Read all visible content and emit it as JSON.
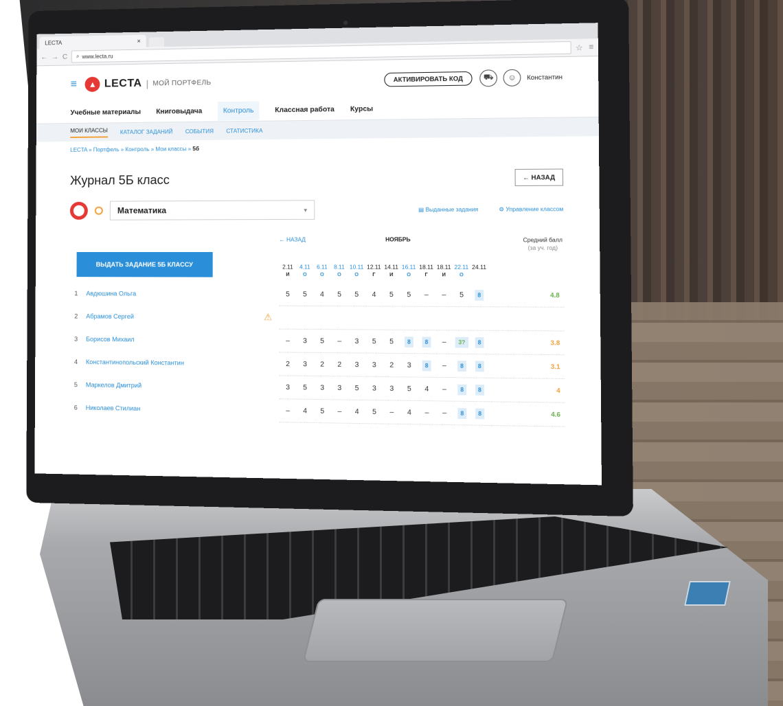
{
  "browser": {
    "tab_title": "LECTA",
    "tab_close": "×",
    "url": "www.lecta.ru"
  },
  "header": {
    "brand": "LECTA",
    "separator": "|",
    "subtitle": "МОЙ ПОРТФЕЛЬ",
    "activate_label": "АКТИВИРОВАТЬ КОД",
    "user_name": "Константин"
  },
  "main_nav": [
    {
      "label": "Учебные материалы"
    },
    {
      "label": "Книговыдача"
    },
    {
      "label": "Контроль",
      "active": true
    },
    {
      "label": "Классная работа"
    },
    {
      "label": "Курсы"
    }
  ],
  "sub_nav": [
    {
      "label": "МОИ КЛАССЫ",
      "active": true
    },
    {
      "label": "КАТАЛОГ ЗАДАНИЙ"
    },
    {
      "label": "СОБЫТИЯ"
    },
    {
      "label": "СТАТИСТИКА"
    }
  ],
  "breadcrumb": {
    "path": "LECTA » Портфель » Контроль » Мои классы » ",
    "current": "5б"
  },
  "page": {
    "title": "Журнал 5Б класс",
    "back_label": "← НАЗАД",
    "subject": "Математика",
    "link_issued": "Выданные задания",
    "link_manage": "Управление классом",
    "assign_label": "ВЫДАТЬ ЗАДАНИЕ 5Б КЛАССУ"
  },
  "journal": {
    "back_link": "← НАЗАД",
    "month": "НОЯБРЬ",
    "avg_title": "Средний балл",
    "avg_sub": "(за уч. год)",
    "dates": [
      {
        "d": "2.11",
        "t": "И",
        "blue": false
      },
      {
        "d": "4.11",
        "t": "О",
        "blue": true
      },
      {
        "d": "6.11",
        "t": "О",
        "blue": true
      },
      {
        "d": "8.11",
        "t": "О",
        "blue": true
      },
      {
        "d": "10.11",
        "t": "О",
        "blue": true
      },
      {
        "d": "12.11",
        "t": "Г",
        "blue": false
      },
      {
        "d": "14.11",
        "t": "И",
        "blue": false
      },
      {
        "d": "16.11",
        "t": "О",
        "blue": true
      },
      {
        "d": "18.11",
        "t": "Г",
        "blue": false
      },
      {
        "d": "18.11",
        "t": "И",
        "blue": false
      },
      {
        "d": "22.11",
        "t": "О",
        "blue": true
      },
      {
        "d": "24.11",
        "t": "",
        "blue": false
      }
    ],
    "students": [
      {
        "num": "1",
        "name": "Авдюшина Ольга",
        "marks": [
          "5",
          "5",
          "4",
          "5",
          "5",
          "4",
          "5",
          "5",
          "–",
          "–",
          "5",
          "8"
        ],
        "avg": "4.8",
        "avg_color": "green"
      },
      {
        "num": "2",
        "name": "Абрамов Сергей",
        "warn": "⚠",
        "marks": [
          "",
          "",
          "",
          "",
          "",
          "",
          "",
          "",
          "",
          "",
          "",
          ""
        ],
        "avg": "",
        "avg_color": ""
      },
      {
        "num": "3",
        "name": "Борисов Михаил",
        "marks": [
          "–",
          "3",
          "5",
          "–",
          "3",
          "5",
          "5",
          "8",
          "8",
          "–",
          "3?",
          "8"
        ],
        "avg": "3.8",
        "avg_color": "orange"
      },
      {
        "num": "4",
        "name": "Константинопольский Константин",
        "marks": [
          "2",
          "3",
          "2",
          "2",
          "3",
          "3",
          "2",
          "3",
          "8",
          "–",
          "8",
          "8"
        ],
        "avg": "3.1",
        "avg_color": "orange"
      },
      {
        "num": "5",
        "name": "Маркелов Дмитрий",
        "marks": [
          "3",
          "5",
          "3",
          "3",
          "5",
          "3",
          "3",
          "5",
          "4",
          "–",
          "8",
          "8"
        ],
        "avg": "4",
        "avg_color": "orange"
      },
      {
        "num": "6",
        "name": "Николаев Стилиан",
        "marks": [
          "–",
          "4",
          "5",
          "–",
          "4",
          "5",
          "–",
          "4",
          "–",
          "–",
          "8",
          "8"
        ],
        "avg": "4.6",
        "avg_color": "green"
      }
    ]
  }
}
